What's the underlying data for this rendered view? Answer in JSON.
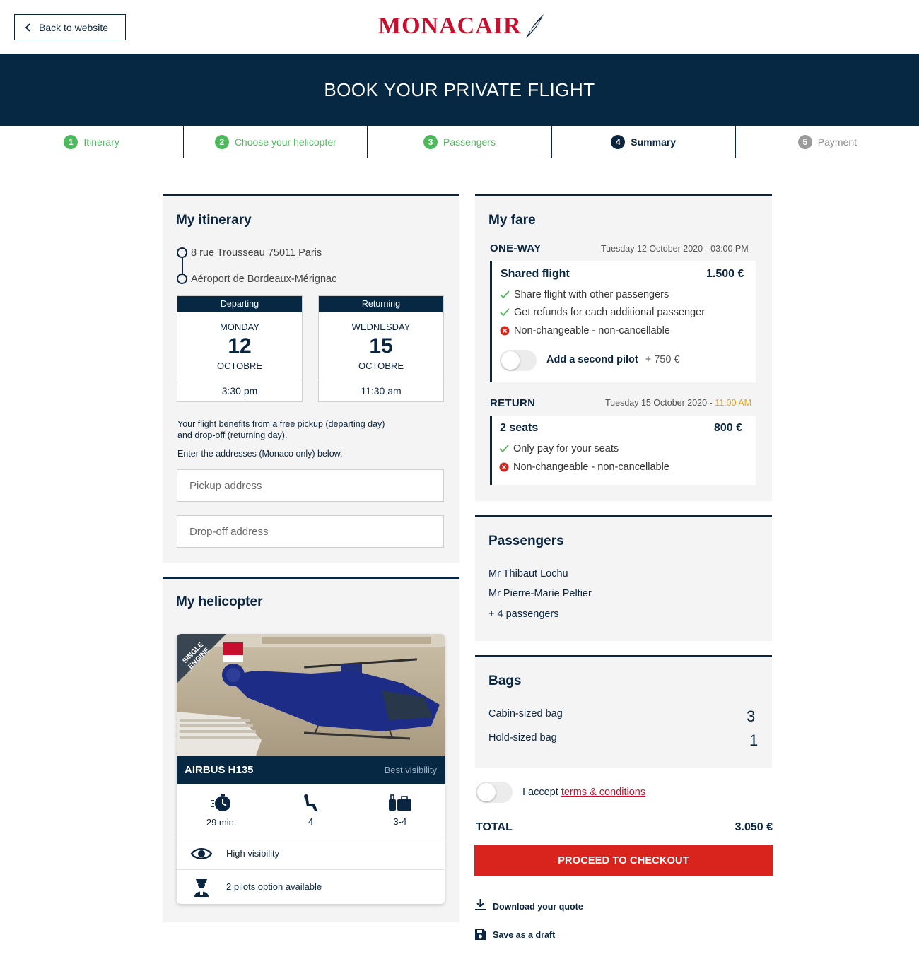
{
  "header": {
    "back_label": "Back to website",
    "logo_text": "MONACAIR",
    "brand_color": "#c8102e",
    "banner_title": "BOOK YOUR PRIVATE FLIGHT"
  },
  "steps": [
    {
      "num": "1",
      "label": "Itinerary",
      "state": "done"
    },
    {
      "num": "2",
      "label": "Choose your helicopter",
      "state": "done"
    },
    {
      "num": "3",
      "label": "Passengers",
      "state": "done"
    },
    {
      "num": "4",
      "label": "Summary",
      "state": "active"
    },
    {
      "num": "5",
      "label": "Payment",
      "state": "todo"
    }
  ],
  "itinerary": {
    "title": "My itinerary",
    "from": "8 rue Trousseau 75011 Paris",
    "to": "Aéroport de Bordeaux-Mérignac",
    "departing": {
      "head": "Departing",
      "day": "MONDAY",
      "date": "12",
      "month": "OCTOBRE",
      "time": "3:30 pm"
    },
    "returning": {
      "head": "Returning",
      "day": "WEDNESDAY",
      "date": "15",
      "month": "OCTOBRE",
      "time": "11:30 am"
    },
    "info_line1": "Your flight benefits from a free pickup (departing day)",
    "info_line2": "and drop-off (returning day).",
    "info_line3": "Enter the addresses (Monaco only) below.",
    "pickup_placeholder": "Pickup address",
    "dropoff_placeholder": "Drop-off address"
  },
  "helicopter": {
    "title": "My helicopter",
    "badge_line1": "SINGLE",
    "badge_line2": "ENGINE",
    "name": "AIRBUS H135",
    "tagline": "Best visibility",
    "duration": "29 min.",
    "seats": "4",
    "bags": "3-4",
    "feature1": "High visibility",
    "feature2": "2 pilots option available"
  },
  "fare": {
    "title": "My fare",
    "oneway": {
      "label": "ONE-WAY",
      "date": "Tuesday 12 October 2020 - 03:00 PM",
      "name": "Shared flight",
      "price": "1.500 €",
      "features": [
        {
          "text": "Share flight with other passengers",
          "ok": true
        },
        {
          "text": "Get refunds for each additional passenger",
          "ok": true
        },
        {
          "text": "Non-changeable - non-cancellable",
          "ok": false
        }
      ],
      "pilot_label": "Add a second pilot",
      "pilot_price": "+ 750 €"
    },
    "return": {
      "label": "RETURN",
      "date_prefix": "Tuesday 15 October 2020 - ",
      "date_time": "11:00 AM",
      "name": "2 seats",
      "price": "800 €",
      "features": [
        {
          "text": "Only pay for your seats",
          "ok": true
        },
        {
          "text": "Non-changeable - non-cancellable",
          "ok": false
        }
      ]
    }
  },
  "passengers": {
    "title": "Passengers",
    "list": [
      "Mr Thibaut Lochu",
      "Mr Pierre-Marie Peltier",
      "+ 4 passengers"
    ]
  },
  "bags": {
    "title": "Bags",
    "cabin_label": "Cabin-sized bag",
    "cabin_count": "3",
    "hold_label": "Hold-sized bag",
    "hold_count": "1"
  },
  "checkout": {
    "accept_text": "I accept ",
    "terms_link": "terms & conditions",
    "total_label": "TOTAL",
    "total_value": "3.050 €",
    "button_label": "PROCEED TO CHECKOUT",
    "download_label": "Download your quote",
    "draft_label": "Save as a draft"
  },
  "colors": {
    "navy": "#062843",
    "green": "#4cba5a",
    "red": "#d8241c",
    "accent_orange": "#e8a317"
  }
}
